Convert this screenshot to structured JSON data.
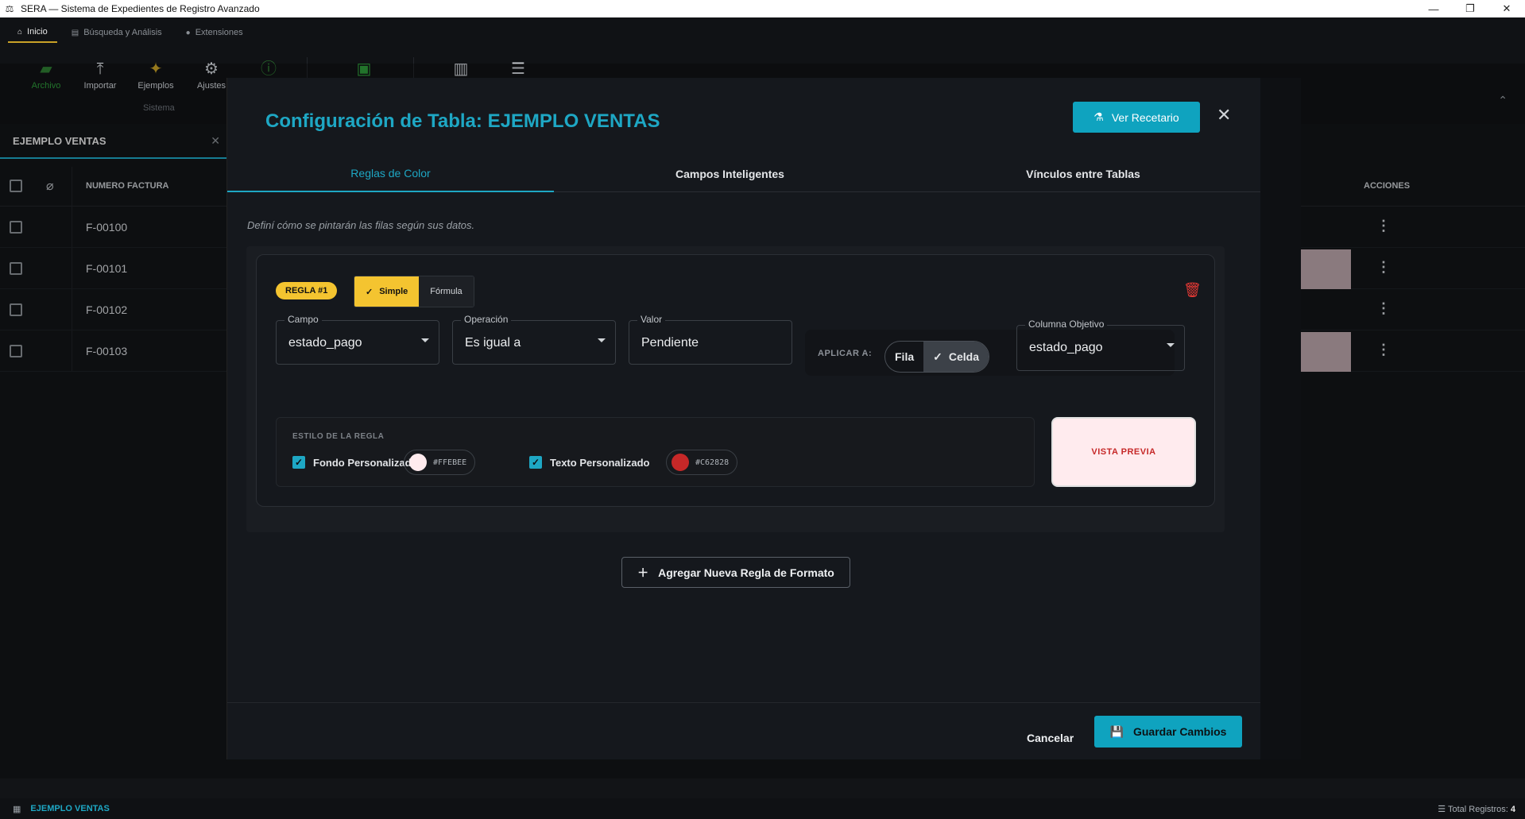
{
  "window": {
    "title": "SERA — Sistema de Expedientes de Registro Avanzado",
    "icon": "sera-app-icon"
  },
  "ribbon": {
    "tabs": [
      {
        "label": "Inicio",
        "icon": "home-icon",
        "active": true
      },
      {
        "label": "Búsqueda y Análisis",
        "icon": "chart-icon",
        "active": false
      },
      {
        "label": "Extensiones",
        "icon": "puzzle-icon",
        "active": false
      }
    ],
    "buttons": [
      {
        "label": "Archivo",
        "icon": "folder-icon",
        "color": "#2e7d32"
      },
      {
        "label": "Importar",
        "icon": "upload-icon"
      },
      {
        "label": "Ejemplos",
        "icon": "sparkle-icon",
        "color": "#c9a227"
      },
      {
        "label": "Ajustes",
        "icon": "gear-icon"
      }
    ],
    "section_label": "Sistema"
  },
  "panel": {
    "table_name": "EJEMPLO VENTAS",
    "columns": {
      "invoice": "NUMERO FACTURA",
      "actions": "ACCIONES"
    },
    "rows": [
      {
        "invoice": "F-00100",
        "tinted": false
      },
      {
        "invoice": "F-00101",
        "tinted": true
      },
      {
        "invoice": "F-00102",
        "tinted": false
      },
      {
        "invoice": "F-00103",
        "tinted": true
      }
    ]
  },
  "statusbar": {
    "table": "EJEMPLO VENTAS",
    "total_label": "Total Registros:",
    "total_value": "4"
  },
  "dialog": {
    "title": "Configuración de Tabla: EJEMPLO VENTAS",
    "recipe_button": "Ver Recetario",
    "tabs": [
      {
        "label": "Reglas de Color",
        "active": true
      },
      {
        "label": "Campos Inteligentes",
        "active": false
      },
      {
        "label": "Vínculos entre Tablas",
        "active": false
      }
    ],
    "hint": "Definí cómo se pintarán las filas según sus datos.",
    "rule": {
      "badge": "REGLA #1",
      "mode_options": [
        "Simple",
        "Fórmula"
      ],
      "mode_selected": "Simple",
      "campo_label": "Campo",
      "campo_value": "estado_pago",
      "operacion_label": "Operación",
      "operacion_value": "Es igual a",
      "valor_label": "Valor",
      "valor_value": "Pendiente",
      "apply_label": "APLICAR A:",
      "apply_options": [
        "Fila",
        "Celda"
      ],
      "apply_selected": "Celda",
      "target_label": "Columna Objetivo",
      "target_value": "estado_pago",
      "style_title": "ESTILO DE LA REGLA",
      "bg_label": "Fondo Personalizado",
      "bg_hex": "#FFEBEE",
      "text_label": "Texto Personalizado",
      "text_hex": "#C62828",
      "preview": "VISTA PREVIA"
    },
    "add_rule_button": "Agregar Nueva Regla de Formato",
    "cancel_button": "Cancelar",
    "save_button": "Guardar Cambios"
  },
  "colors": {
    "accent": "#1ea7c4",
    "highlight": "#f4c430",
    "danger": "#e53935"
  }
}
